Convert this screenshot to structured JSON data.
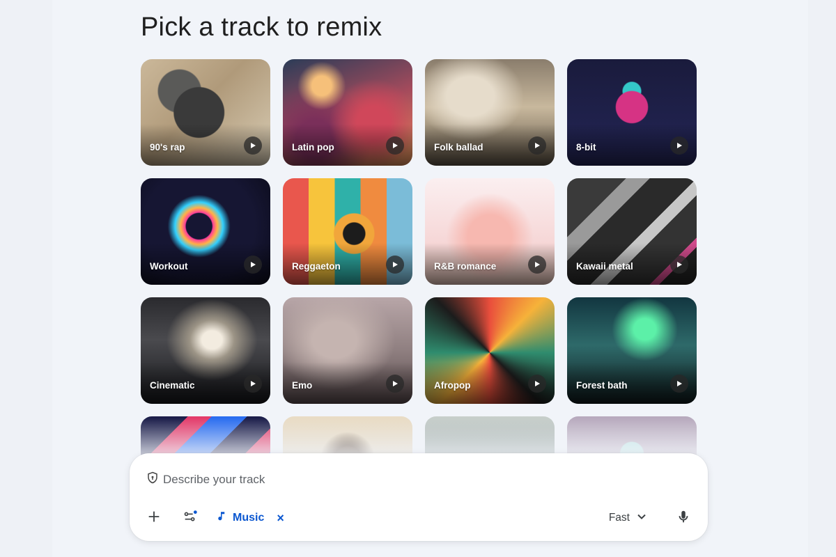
{
  "page": {
    "title": "Pick a track to remix"
  },
  "tracks": [
    {
      "label": "90's rap"
    },
    {
      "label": "Latin pop"
    },
    {
      "label": "Folk ballad"
    },
    {
      "label": "8-bit"
    },
    {
      "label": "Workout"
    },
    {
      "label": "Reggaeton"
    },
    {
      "label": "R&B romance"
    },
    {
      "label": "Kawaii metal"
    },
    {
      "label": "Cinematic"
    },
    {
      "label": "Emo"
    },
    {
      "label": "Afropop"
    },
    {
      "label": "Forest bath"
    },
    {
      "label": ""
    },
    {
      "label": ""
    },
    {
      "label": ""
    },
    {
      "label": ""
    }
  ],
  "composer": {
    "placeholder": "Describe your track",
    "chip_label": "Music",
    "chip_close": "×",
    "speed": "Fast",
    "icons": {
      "shield": "shield-icon",
      "add": "plus-icon",
      "settings": "sliders-icon",
      "music": "music-note-icon",
      "chevron": "chevron-down-icon",
      "mic": "microphone-icon"
    },
    "accent": "#0b57d0"
  }
}
